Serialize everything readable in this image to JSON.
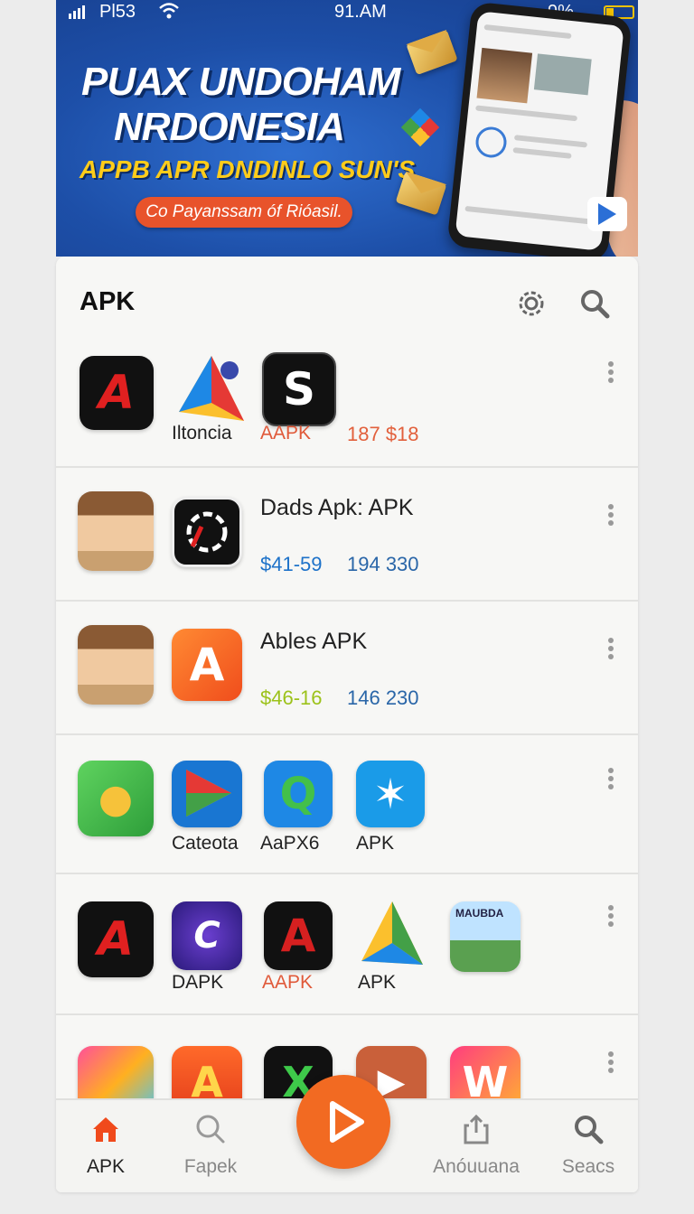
{
  "status_bar": {
    "carrier": "Pl53",
    "time": "91.AM",
    "battery": "9%"
  },
  "banner": {
    "title_line1": "PUAX UNDOHAM",
    "title_line2": "NRDONESIA",
    "subtitle": "APPB APR DNDINLO SUN'S",
    "cta": "Co Payanssam óf Rióasil."
  },
  "panel": {
    "title": "APK"
  },
  "rows": [
    {
      "captions": [
        "",
        "Iltoncia",
        "AAPK"
      ],
      "price": "187 $18"
    },
    {
      "title": "Dads Apk: APK",
      "price_a": "$41-59",
      "price_b": "194 330"
    },
    {
      "title": "Ables APK",
      "price_a": "$46-16",
      "price_b": "146 230"
    },
    {
      "captions": [
        "Cateota",
        "AaPX6",
        "APK"
      ]
    },
    {
      "captions": [
        "DAPK",
        "AAPK",
        "APK"
      ],
      "thumb_text": "MAUBDA"
    }
  ],
  "nav": {
    "items": [
      {
        "label": "APK"
      },
      {
        "label": "Fapek"
      },
      {
        "label": "Anóuuana"
      },
      {
        "label": "Seacs"
      }
    ]
  },
  "colors": {
    "accent": "#f26a22",
    "banner": "#1d4fa8",
    "cta": "#e8532b"
  }
}
